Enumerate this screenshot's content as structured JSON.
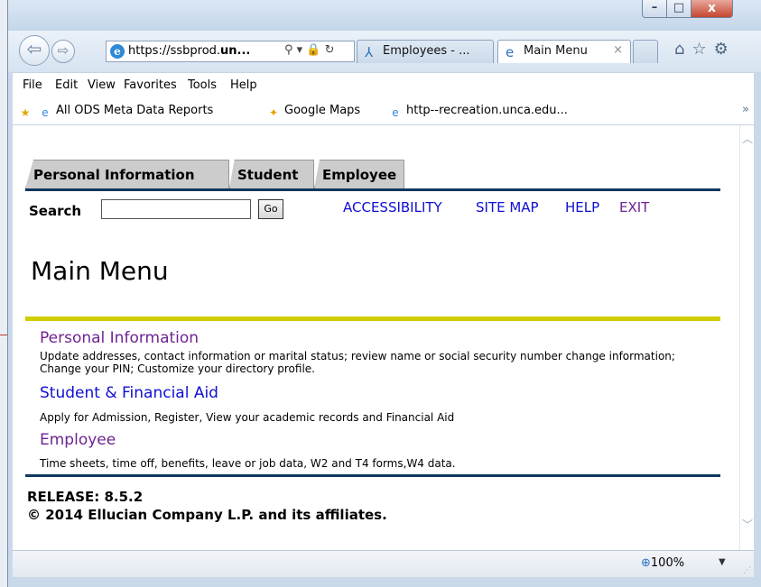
{
  "browser": {
    "address_url_prefix": "https://ssbprod.",
    "address_url_host": "un...",
    "tabs": [
      {
        "label": "Employees - ...",
        "active": false
      },
      {
        "label": "Main Menu",
        "active": true,
        "close": "×"
      }
    ],
    "window_controls": {
      "minimize": "–",
      "maximize": "□",
      "close": "x"
    },
    "menu": [
      "File",
      "Edit",
      "View",
      "Favorites",
      "Tools",
      "Help"
    ],
    "favorites": [
      "All ODS Meta Data Reports",
      "Google Maps",
      "http--recreation.unca.edu..."
    ],
    "zoom": "100%"
  },
  "page": {
    "tabs": [
      "Personal Information",
      "Student",
      "Employee"
    ],
    "search_label": "Search",
    "search_value": "",
    "go_label": "Go",
    "top_links": [
      {
        "label": "ACCESSIBILITY",
        "visited": false
      },
      {
        "label": "SITE MAP",
        "visited": false
      },
      {
        "label": "HELP",
        "visited": false
      },
      {
        "label": "EXIT",
        "visited": true
      }
    ],
    "title": "Main Menu",
    "sections": [
      {
        "title": "Personal Information",
        "visited": true,
        "description": "Update addresses, contact information or marital status; review name or social security number change information; Change your PIN; Customize your directory profile."
      },
      {
        "title": "Student & Financial Aid",
        "visited": false,
        "description": "Apply for Admission, Register, View your academic records and Financial Aid"
      },
      {
        "title": "Employee",
        "visited": true,
        "description": "Time sheets, time off, benefits, leave or job data, W2 and T4 forms,W4 data."
      }
    ],
    "release": "RELEASE: 8.5.2",
    "copyright": "© 2014 Ellucian Company L.P. and its affiliates."
  },
  "colors": {
    "link": "#0f0fd1",
    "visited_link": "#6f2392",
    "navy_rule": "#10385f",
    "gold_rule": "#cfcc00",
    "tab_gray": "#cccccc"
  }
}
